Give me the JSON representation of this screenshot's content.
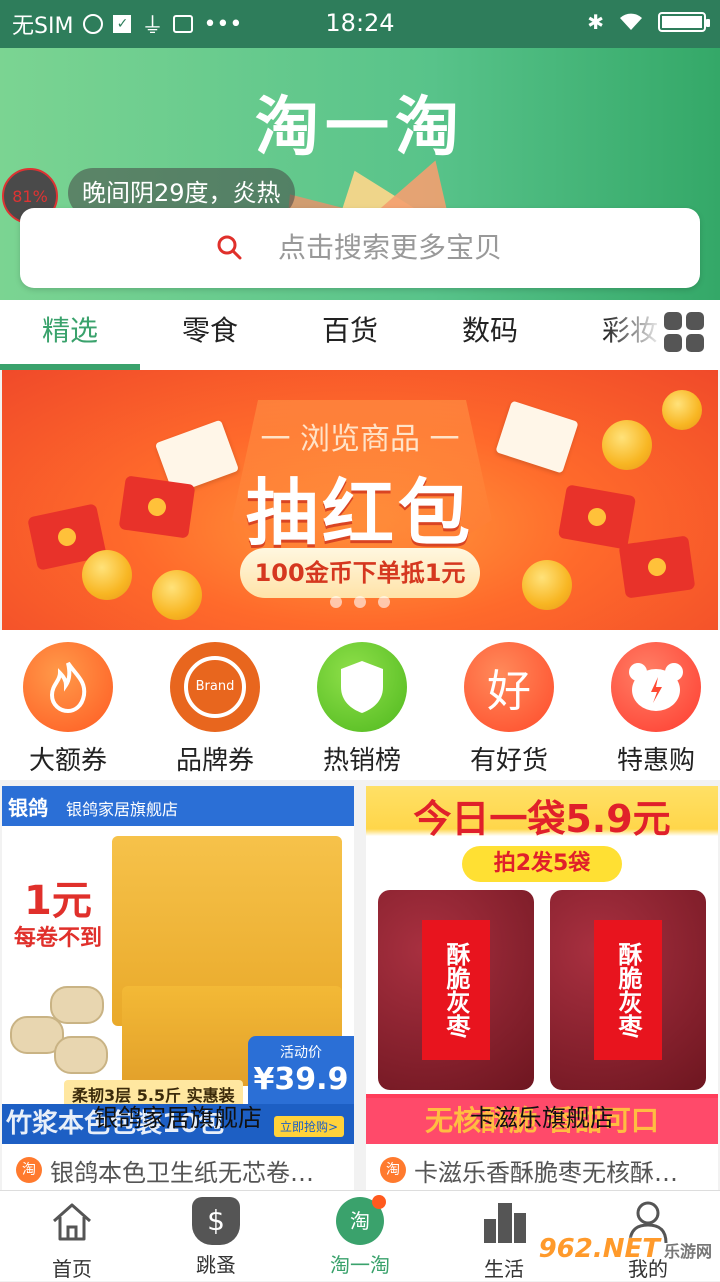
{
  "status": {
    "carrier": "无SIM",
    "time": "18:24",
    "icons": [
      "circle-logo-icon",
      "check-icon",
      "usb-icon",
      "debug-icon",
      "more-dots-icon",
      "bluetooth-icon",
      "wifi-icon",
      "battery-icon"
    ],
    "more": "•••"
  },
  "header": {
    "title": "淘一淘",
    "humidity": "81%",
    "weather": "晚间阴29度，炎热",
    "search_placeholder": "点击搜索更多宝贝"
  },
  "tabs": {
    "items": [
      {
        "label": "精选",
        "active": true
      },
      {
        "label": "零食",
        "active": false
      },
      {
        "label": "百货",
        "active": false
      },
      {
        "label": "数码",
        "active": false
      },
      {
        "label": "彩妆",
        "active": false
      }
    ]
  },
  "banner": {
    "subtitle": "一 浏览商品 一",
    "headline": "抽红包",
    "pill": "100金币下单抵1元",
    "page_count": 3
  },
  "categories": [
    {
      "label": "大额券",
      "icon": "fire-icon",
      "color": "#ff6a2c"
    },
    {
      "label": "品牌券",
      "icon": "brand-badge-icon",
      "color": "#e8661e",
      "badge_text": "Brand"
    },
    {
      "label": "热销榜",
      "icon": "shield-icon",
      "color": "#5cc225"
    },
    {
      "label": "有好货",
      "icon": "good-icon",
      "color": "#ff5a3a",
      "badge_text": "好"
    },
    {
      "label": "特惠购",
      "icon": "bear-icon",
      "color": "#ff4e3a"
    }
  ],
  "products": [
    {
      "shop": "银鸽家居旗舰店",
      "title": "银鸽本色卫生纸无芯卷…",
      "img_brand": "银鸽",
      "img_shop": "银鸽家居旗舰店",
      "img_price_big": "1元",
      "img_price_note": "每卷不到",
      "img_spec": "柔韧3层 5.5斤 实惠装",
      "img_price_label": "活动价",
      "img_price": "¥39.9",
      "img_bottom": "竹浆本色包装10包",
      "img_cta": "立即抢购>"
    },
    {
      "shop": "卡滋乐旗舰店",
      "title": "卡滋乐香酥脆枣无核酥…",
      "img_top": "今日一袋5.9元",
      "img_tag": "拍2发5袋",
      "img_bag": "酥脆灰枣",
      "img_bottom": "无核酥脆 香甜可口"
    }
  ],
  "bottom_nav": [
    {
      "label": "首页",
      "icon": "home-icon",
      "active": false
    },
    {
      "label": "跳蚤",
      "icon": "money-bag-icon",
      "active": false
    },
    {
      "label": "淘一淘",
      "icon": "tao-icon",
      "active": true
    },
    {
      "label": "生活",
      "icon": "city-icon",
      "active": false
    },
    {
      "label": "我的",
      "icon": "user-icon",
      "active": false
    }
  ],
  "watermark": {
    "text": "962.NET",
    "sub": "乐游网"
  },
  "colors": {
    "primary_green": "#3aa26c",
    "header_green": "#58c38a",
    "status_bar": "#2e7d5b"
  }
}
